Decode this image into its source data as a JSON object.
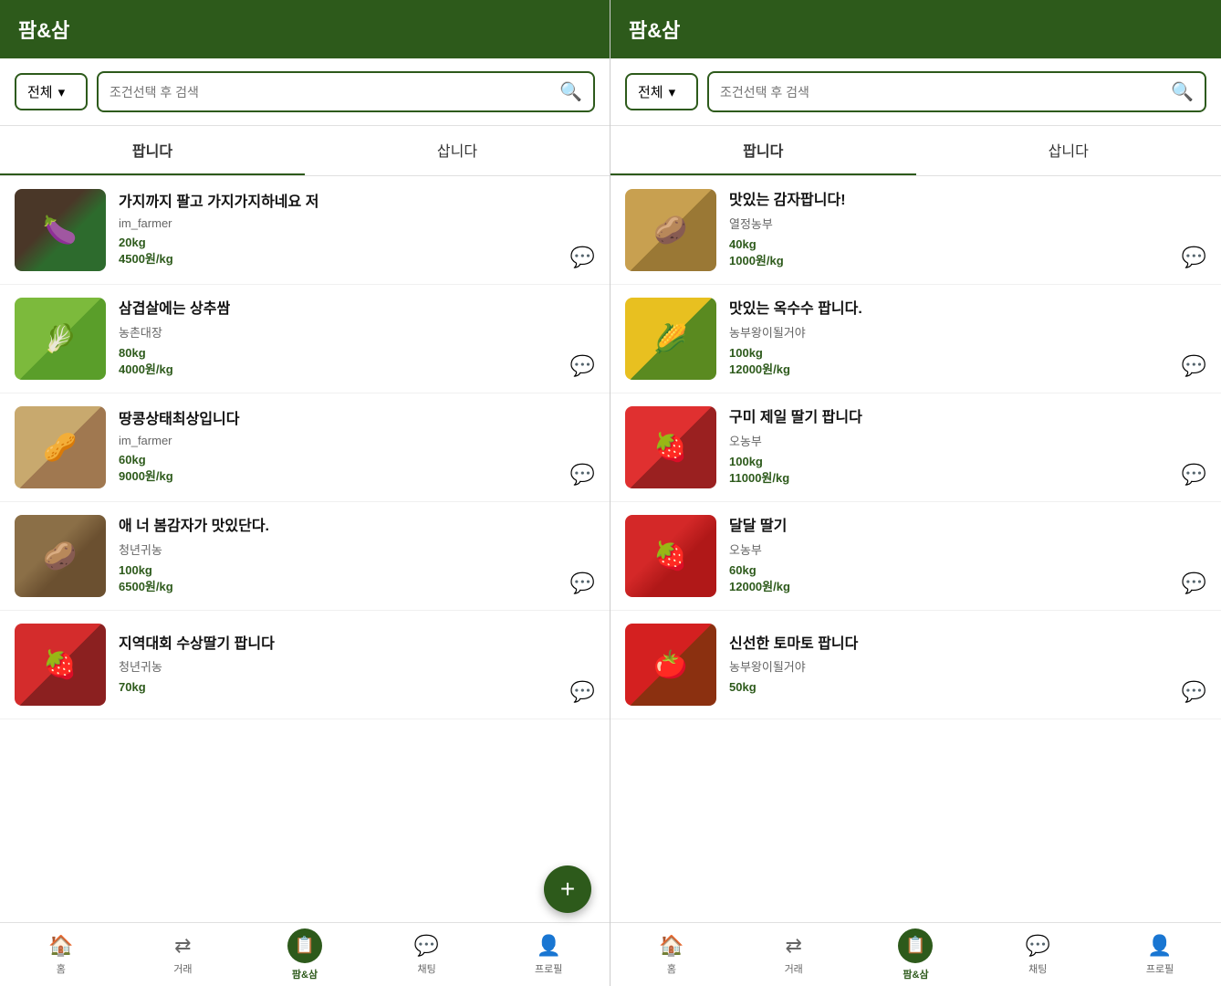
{
  "app": {
    "title": "팜&삼"
  },
  "search": {
    "dropdown_label": "전체",
    "placeholder": "조건선택 후 검색"
  },
  "tabs": {
    "sell": "팝니다",
    "buy": "삽니다"
  },
  "left_products": [
    {
      "title": "가지까지 팔고 가지가지하네요 저",
      "seller": "im_farmer",
      "amount": "20kg",
      "price": "4500원/kg",
      "img_class": "img-eggplant",
      "emoji": "🍆"
    },
    {
      "title": "삼겹살에는 상추쌈",
      "seller": "농촌대장",
      "amount": "80kg",
      "price": "4000원/kg",
      "img_class": "img-lettuce",
      "emoji": "🥬"
    },
    {
      "title": "땅콩상태최상입니다",
      "seller": "im_farmer",
      "amount": "60kg",
      "price": "9000원/kg",
      "img_class": "img-peanut",
      "emoji": "🥜"
    },
    {
      "title": "애 너 봄감자가 맛있단다.",
      "seller": "청년귀농",
      "amount": "100kg",
      "price": "6500원/kg",
      "img_class": "img-potato",
      "emoji": "🥔"
    },
    {
      "title": "지역대회 수상딸기 팝니다",
      "seller": "청년귀농",
      "amount": "70kg",
      "price": "",
      "img_class": "img-strawberry",
      "emoji": "🍓"
    }
  ],
  "right_products": [
    {
      "title": "맛있는 감자팝니다!",
      "seller": "열정농부",
      "amount": "40kg",
      "price": "1000원/kg",
      "img_class": "img-potato2",
      "emoji": "🥔"
    },
    {
      "title": "맛있는 옥수수 팝니다.",
      "seller": "농부왕이될거야",
      "amount": "100kg",
      "price": "12000원/kg",
      "img_class": "img-corn",
      "emoji": "🌽"
    },
    {
      "title": "구미 제일 딸기 팝니다",
      "seller": "오농부",
      "amount": "100kg",
      "price": "11000원/kg",
      "img_class": "img-strawberry2",
      "emoji": "🍓"
    },
    {
      "title": "달달 딸기",
      "seller": "오농부",
      "amount": "60kg",
      "price": "12000원/kg",
      "img_class": "img-strawberry3",
      "emoji": "🍓"
    },
    {
      "title": "신선한 토마토 팝니다",
      "seller": "농부왕이될거야",
      "amount": "50kg",
      "price": "",
      "img_class": "img-tomato",
      "emoji": "🍅"
    }
  ],
  "nav": {
    "items": [
      {
        "label": "홈",
        "icon": "🏠"
      },
      {
        "label": "거래",
        "icon": "⇄"
      },
      {
        "label": "팜&삼",
        "icon": "📋",
        "active": true
      },
      {
        "label": "채팅",
        "icon": "💬"
      },
      {
        "label": "프로필",
        "icon": "👤"
      }
    ]
  }
}
